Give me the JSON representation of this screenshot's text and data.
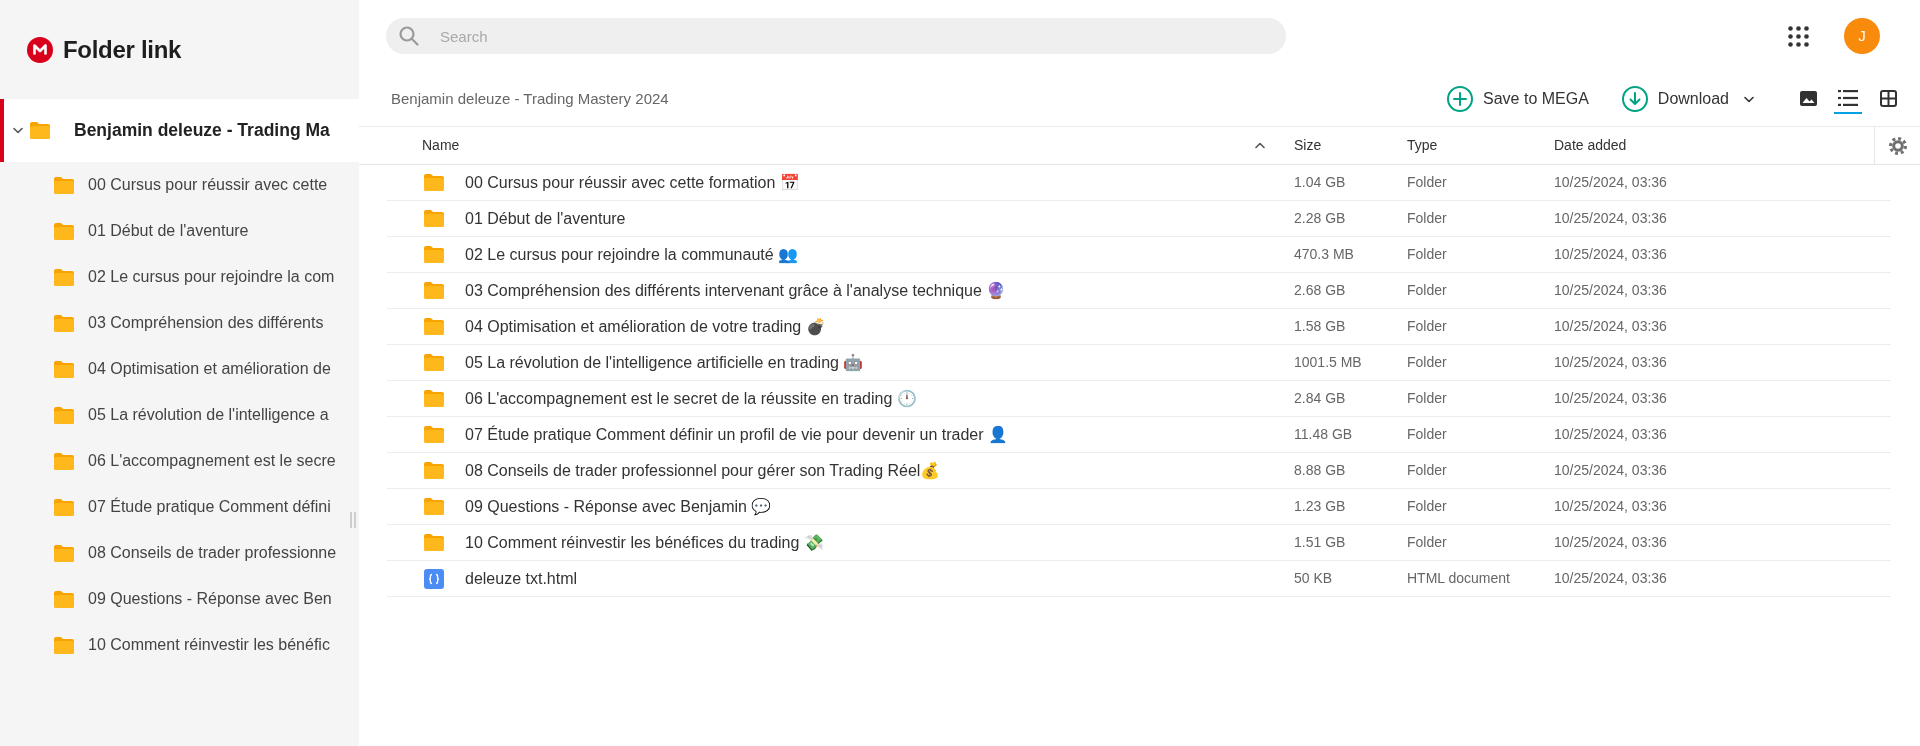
{
  "sidebar": {
    "title": "Folder link",
    "tree": [
      {
        "label": "Benjamin deleuze - Trading Ma",
        "expanded": true,
        "selected": true,
        "children": [
          {
            "label": "00 Cursus pour réussir avec cette",
            "selected": false
          },
          {
            "label": "01 Début de l'aventure",
            "selected": false
          },
          {
            "label": "02 Le cursus pour rejoindre la com",
            "selected": false
          },
          {
            "label": "03 Compréhension des différents",
            "selected": false
          },
          {
            "label": "04 Optimisation et amélioration de",
            "selected": false
          },
          {
            "label": "05 La révolution de l'intelligence a",
            "selected": false
          },
          {
            "label": "06 L'accompagnement est le secre",
            "selected": false
          },
          {
            "label": "07 Étude pratique Comment défini",
            "selected": false
          },
          {
            "label": "08 Conseils de trader professionne",
            "selected": false
          },
          {
            "label": "09 Questions - Réponse avec Ben",
            "selected": false
          },
          {
            "label": "10 Comment réinvestir les bénéfic",
            "selected": false
          }
        ]
      }
    ]
  },
  "search": {
    "placeholder": "Search"
  },
  "account": {
    "avatar": "J"
  },
  "toolbar": {
    "breadcrumb": "Benjamin deleuze - Trading Mastery 2024",
    "actions": [
      {
        "kind": "save",
        "label": "Save to MEGA",
        "has_menu": false
      },
      {
        "kind": "download",
        "label": "Download",
        "has_menu": true
      }
    ],
    "view_modes": [
      {
        "kind": "thumbnails",
        "selected": false
      },
      {
        "kind": "list",
        "selected": true
      },
      {
        "kind": "grid",
        "selected": false
      }
    ]
  },
  "table": {
    "columns": [
      {
        "label": "Name",
        "sorted": true
      },
      {
        "label": "Size",
        "sorted": false
      },
      {
        "label": "Type",
        "sorted": false
      },
      {
        "label": "Date added",
        "sorted": false
      }
    ],
    "rows": [
      {
        "kind": "folder",
        "name": "00 Cursus pour réussir avec cette formation 📅",
        "size": "1.04 GB",
        "type": "Folder",
        "date": "10/25/2024, 03:36"
      },
      {
        "kind": "folder",
        "name": "01 Début de l'aventure",
        "size": "2.28 GB",
        "type": "Folder",
        "date": "10/25/2024, 03:36"
      },
      {
        "kind": "folder",
        "name": "02 Le cursus pour rejoindre la communauté 👥",
        "size": "470.3 MB",
        "type": "Folder",
        "date": "10/25/2024, 03:36"
      },
      {
        "kind": "folder",
        "name": "03 Compréhension des différents intervenant grâce à l'analyse technique 🔮",
        "size": "2.68 GB",
        "type": "Folder",
        "date": "10/25/2024, 03:36"
      },
      {
        "kind": "folder",
        "name": "04 Optimisation et amélioration de votre trading 💣",
        "size": "1.58 GB",
        "type": "Folder",
        "date": "10/25/2024, 03:36"
      },
      {
        "kind": "folder",
        "name": "05 La révolution de l'intelligence artificielle en trading 🤖",
        "size": "1001.5 MB",
        "type": "Folder",
        "date": "10/25/2024, 03:36"
      },
      {
        "kind": "folder",
        "name": "06 L'accompagnement est le secret de la réussite en trading 🕛",
        "size": "2.84 GB",
        "type": "Folder",
        "date": "10/25/2024, 03:36"
      },
      {
        "kind": "folder",
        "name": "07 Étude pratique Comment définir un profil de vie pour devenir un trader 👤",
        "size": "11.48 GB",
        "type": "Folder",
        "date": "10/25/2024, 03:36"
      },
      {
        "kind": "folder",
        "name": "08 Conseils de trader professionnel pour gérer son Trading Réel💰",
        "size": "8.88 GB",
        "type": "Folder",
        "date": "10/25/2024, 03:36"
      },
      {
        "kind": "folder",
        "name": "09 Questions - Réponse avec Benjamin 💬",
        "size": "1.23 GB",
        "type": "Folder",
        "date": "10/25/2024, 03:36"
      },
      {
        "kind": "folder",
        "name": "10 Comment réinvestir les bénéfices du trading 💸",
        "size": "1.51 GB",
        "type": "Folder",
        "date": "10/25/2024, 03:36"
      },
      {
        "kind": "file",
        "name": "deleuze txt.html",
        "size": "50 KB",
        "type": "HTML document",
        "date": "10/25/2024, 03:36"
      }
    ]
  }
}
